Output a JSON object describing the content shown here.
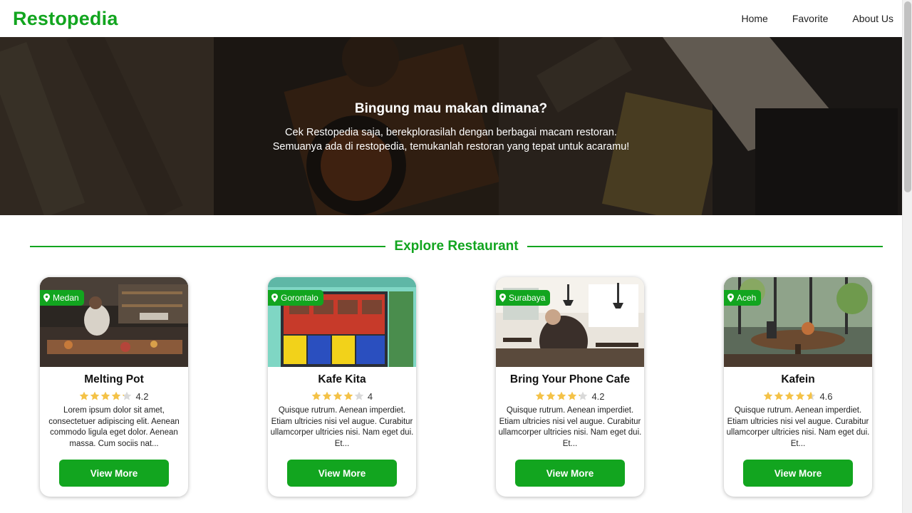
{
  "header": {
    "brand": "Restopedia",
    "nav": [
      "Home",
      "Favorite",
      "About Us"
    ]
  },
  "hero": {
    "title": "Bingung mau makan dimana?",
    "line1": "Cek Restopedia saja, berekplorasilah dengan berbagai macam restoran.",
    "line2": "Semuanya ada di restopedia, temukanlah restoran yang tepat untuk acaramu!"
  },
  "section": {
    "title": "Explore Restaurant"
  },
  "restaurants": [
    {
      "city": "Medan",
      "name": "Melting Pot",
      "rating": "4.2",
      "description": "Lorem ipsum dolor sit amet, consectetuer adipiscing elit. Aenean commodo ligula eget dolor. Aenean massa. Cum sociis nat...",
      "button": "View More"
    },
    {
      "city": "Gorontalo",
      "name": "Kafe Kita",
      "rating": "4",
      "description": "Quisque rutrum. Aenean imperdiet. Etiam ultricies nisi vel augue. Curabitur ullamcorper ultricies nisi. Nam eget dui. Et...",
      "button": "View More"
    },
    {
      "city": "Surabaya",
      "name": "Bring Your Phone Cafe",
      "rating": "4.2",
      "description": "Quisque rutrum. Aenean imperdiet. Etiam ultricies nisi vel augue. Curabitur ullamcorper ultricies nisi. Nam eget dui. Et...",
      "button": "View More"
    },
    {
      "city": "Aceh",
      "name": "Kafein",
      "rating": "4.6",
      "description": "Quisque rutrum. Aenean imperdiet. Etiam ultricies nisi vel augue. Curabitur ullamcorper ultricies nisi. Nam eget dui. Et...",
      "button": "View More"
    }
  ],
  "colors": {
    "brand": "#12a51f",
    "star": "#f4c247",
    "star_empty": "#d9d9d9"
  },
  "icons": {
    "city": "map-pin-icon",
    "rating": "star-icon"
  }
}
